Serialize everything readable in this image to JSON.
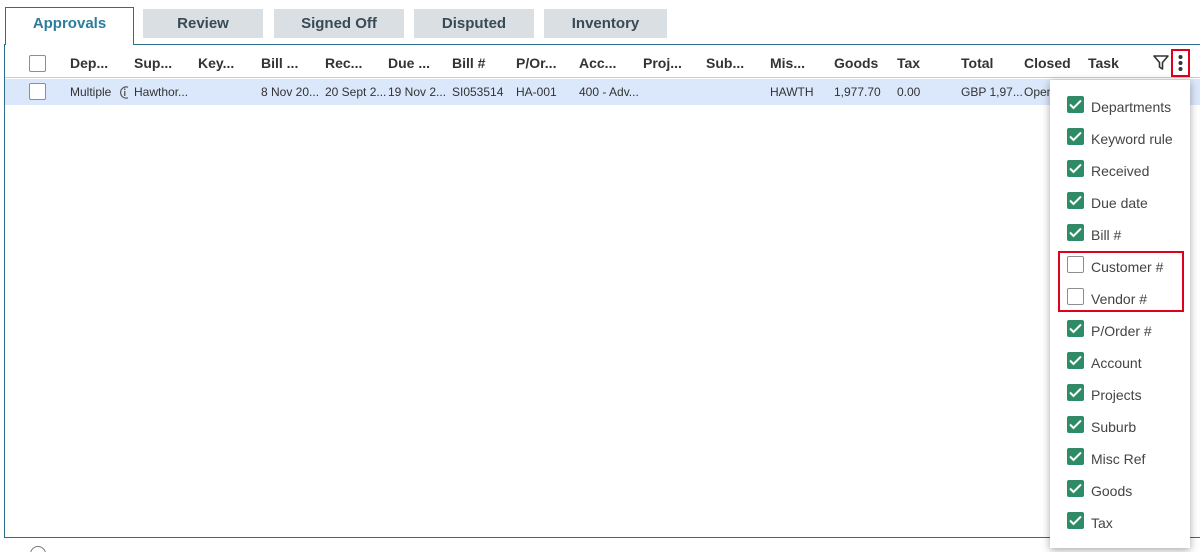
{
  "tabs": [
    {
      "label": "Approvals",
      "active": true
    },
    {
      "label": "Review"
    },
    {
      "label": "Signed Off"
    },
    {
      "label": "Disputed"
    },
    {
      "label": "Inventory"
    }
  ],
  "columns": [
    "Dep...",
    "Sup...",
    "Key...",
    "Bill ...",
    "Rec...",
    "Due ...",
    "Bill #",
    "P/Or...",
    "Acc...",
    "Proj...",
    "Sub...",
    "Mis...",
    "Goods",
    "Tax",
    "Total",
    "Closed",
    "Task"
  ],
  "row": {
    "department": "Multiple",
    "supplier": "Hawthor...",
    "bill_date": "8 Nov 20...",
    "received": "20 Sept 2...",
    "due_date": "19 Nov 2...",
    "bill_number": "SI053514",
    "purchase_order": "HA-001",
    "account": "400 - Adv...",
    "misc": "HAWTH",
    "goods": "1,977.70",
    "tax": "0.00",
    "total": "GBP 1,97...",
    "closed": "Open"
  },
  "icons": {
    "info": "info-icon",
    "filter": "filter-icon",
    "more": "kebab-menu-icon",
    "check": "checkmark-icon"
  },
  "colors": {
    "accent": "#2b7d9b",
    "checkbox_on": "#2e8b65",
    "highlight": "#e0001b",
    "row_selected": "#dbe7fb"
  },
  "column_menu": [
    {
      "label": "Departments",
      "checked": true
    },
    {
      "label": "Keyword rule",
      "checked": true
    },
    {
      "label": "Received",
      "checked": true
    },
    {
      "label": "Due date",
      "checked": true
    },
    {
      "label": "Bill #",
      "checked": true
    },
    {
      "label": "Customer #",
      "checked": false
    },
    {
      "label": "Vendor #",
      "checked": false
    },
    {
      "label": "P/Order #",
      "checked": true
    },
    {
      "label": "Account",
      "checked": true
    },
    {
      "label": "Projects",
      "checked": true
    },
    {
      "label": "Suburb",
      "checked": true
    },
    {
      "label": "Misc Ref",
      "checked": true
    },
    {
      "label": "Goods",
      "checked": true
    },
    {
      "label": "Tax",
      "checked": true
    }
  ]
}
